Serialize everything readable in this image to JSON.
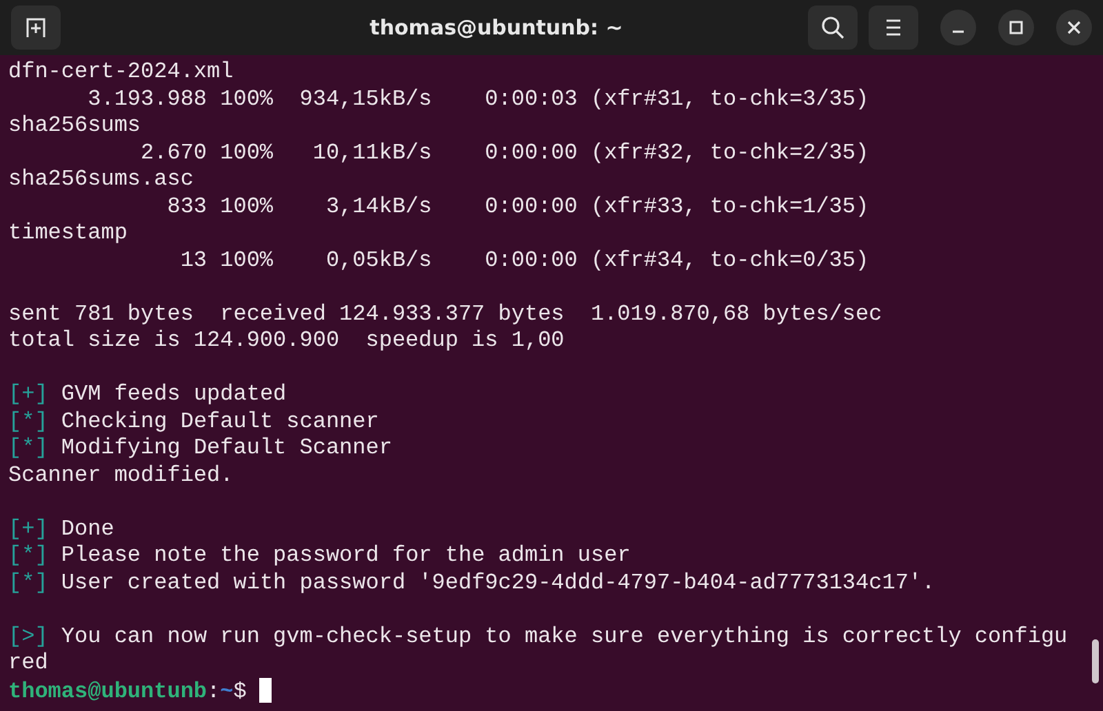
{
  "window": {
    "title": "thomas@ubuntunb: ~"
  },
  "terminal": {
    "lines": [
      {
        "kind": "plain",
        "text": "dfn-cert-2024.xml"
      },
      {
        "kind": "plain",
        "text": "      3.193.988 100%  934,15kB/s    0:00:03 (xfr#31, to-chk=3/35)"
      },
      {
        "kind": "plain",
        "text": "sha256sums"
      },
      {
        "kind": "plain",
        "text": "          2.670 100%   10,11kB/s    0:00:00 (xfr#32, to-chk=2/35)"
      },
      {
        "kind": "plain",
        "text": "sha256sums.asc"
      },
      {
        "kind": "plain",
        "text": "            833 100%    3,14kB/s    0:00:00 (xfr#33, to-chk=1/35)"
      },
      {
        "kind": "plain",
        "text": "timestamp"
      },
      {
        "kind": "plain",
        "text": "             13 100%    0,05kB/s    0:00:00 (xfr#34, to-chk=0/35)"
      },
      {
        "kind": "blank"
      },
      {
        "kind": "plain",
        "text": "sent 781 bytes  received 124.933.377 bytes  1.019.870,68 bytes/sec"
      },
      {
        "kind": "plain",
        "text": "total size is 124.900.900  speedup is 1,00"
      },
      {
        "kind": "blank"
      },
      {
        "kind": "status",
        "marker": "[+]",
        "text": "GVM feeds updated"
      },
      {
        "kind": "status",
        "marker": "[*]",
        "text": "Checking Default scanner"
      },
      {
        "kind": "status",
        "marker": "[*]",
        "text": "Modifying Default Scanner"
      },
      {
        "kind": "plain",
        "text": "Scanner modified."
      },
      {
        "kind": "blank"
      },
      {
        "kind": "status",
        "marker": "[+]",
        "text": "Done"
      },
      {
        "kind": "status",
        "marker": "[*]",
        "text": "Please note the password for the admin user"
      },
      {
        "kind": "status",
        "marker": "[*]",
        "text": "User created with password '9edf9c29-4ddd-4797-b404-ad7773134c17'."
      },
      {
        "kind": "blank"
      },
      {
        "kind": "status",
        "marker": "[>]",
        "text": "You can now run gvm-check-setup to make sure everything is correctly configu"
      },
      {
        "kind": "plain",
        "text": "red"
      },
      {
        "kind": "prompt",
        "user": "thomas@ubuntunb",
        "separator": ":",
        "path": "~",
        "symbol": "$"
      }
    ]
  }
}
